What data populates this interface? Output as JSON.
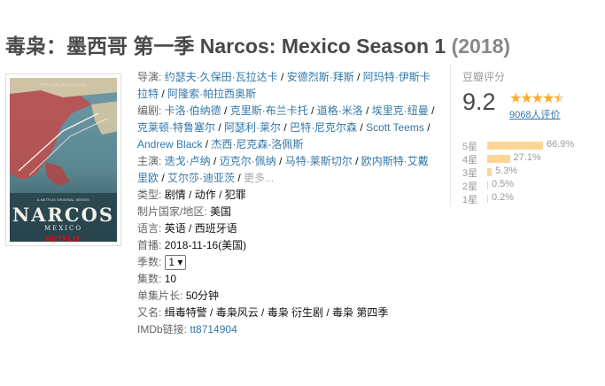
{
  "title": {
    "main": "毒枭：墨西哥 第一季 Narcos: Mexico Season 1",
    "year": "(2018)"
  },
  "poster": {
    "tagline": "THE RISE OF ALL EVIL",
    "original": "A NETFLIX ORIGINAL SERIES",
    "title": "NARCOS",
    "subtitle": "MEXICO",
    "brand": "NETFLIX"
  },
  "info": {
    "director_label": "导演:",
    "directors": [
      "约瑟夫·久保田·瓦拉达卡",
      "安德烈斯·拜斯",
      "阿玛特·伊斯卡拉特",
      "阿隆索·帕拉西奥斯"
    ],
    "writer_label": "编剧:",
    "writers": [
      "卡洛·伯纳德",
      "克里斯·布兰卡托",
      "道格·米洛",
      "埃里克·纽曼",
      "克莱顿·特鲁塞尔",
      "阿瑟利·莱尔",
      "巴特·尼克尔森",
      "Scott Teems",
      "Andrew Black",
      "杰西·尼克森-洛佩斯"
    ],
    "cast_label": "主演:",
    "cast": [
      "迭戈·卢纳",
      "迈克尔·佩纳",
      "马特·莱斯切尔",
      "欧内斯特·艾戴里欧",
      "艾尔莎·迪亚茨"
    ],
    "cast_more": "更多...",
    "genre_label": "类型:",
    "genres": [
      "剧情",
      "动作",
      "犯罪"
    ],
    "country_label": "制片国家/地区:",
    "country": "美国",
    "language_label": "语言:",
    "language": "英语 / 西班牙语",
    "premiere_label": "首播:",
    "premiere": "2018-11-16(美国)",
    "season_label": "季数:",
    "season_selected": "1 ▾",
    "episodes_label": "集数:",
    "episodes": "10",
    "runtime_label": "单集片长:",
    "runtime": "50分钟",
    "aka_label": "又名:",
    "aka": "缉毒特警 / 毒枭风云 / 毒枭 衍生剧 / 毒枭 第四季",
    "imdb_label": "IMDb链接:",
    "imdb": "tt8714904"
  },
  "rating": {
    "label": "豆瓣评分",
    "score": "9.2",
    "stars": 4.5,
    "votes": "9068人评价",
    "distribution": [
      {
        "label": "5星",
        "percent": 66.9,
        "text": "66.9%"
      },
      {
        "label": "4星",
        "percent": 27.1,
        "text": "27.1%"
      },
      {
        "label": "3星",
        "percent": 5.3,
        "text": "5.3%"
      },
      {
        "label": "2星",
        "percent": 0.5,
        "text": "0.5%"
      },
      {
        "label": "1星",
        "percent": 0.2,
        "text": "0.2%"
      }
    ]
  },
  "colors": {
    "link": "#3377aa",
    "star": "#ffac2d",
    "bar": "#ffd596",
    "netflix": "#e50914"
  }
}
